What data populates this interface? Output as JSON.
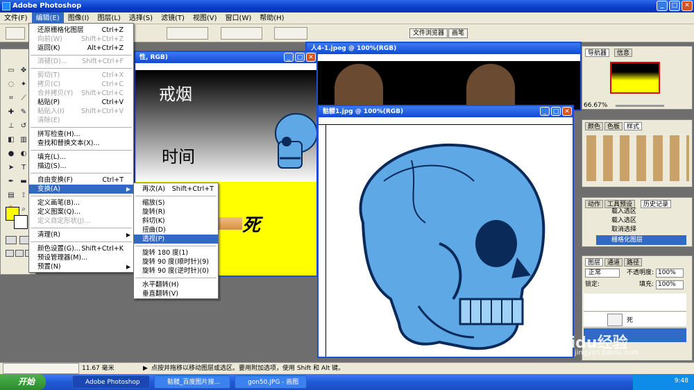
{
  "app": {
    "title": "Adobe Photoshop"
  },
  "menubar": [
    "文件(F)",
    "编辑(E)",
    "图像(I)",
    "图层(L)",
    "选择(S)",
    "滤镜(T)",
    "视图(V)",
    "窗口(W)",
    "帮助(H)"
  ],
  "optbar": {
    "tab1": "文件浏览器",
    "tab2": "画笔"
  },
  "doc1": {
    "title": "性, RGB)",
    "text1": "戒烟",
    "text2": "时间",
    "text3": "死"
  },
  "doc_back": {
    "title": "人4-1.jpeg @ 100%(RGB)"
  },
  "doc2": {
    "title": "骷髅1.jpg @ 100%(RGB)"
  },
  "edit_menu": [
    {
      "label": "还原栅格化图层",
      "shortcut": "Ctrl+Z",
      "disabled": false
    },
    {
      "label": "向前(W)",
      "shortcut": "Shift+Ctrl+Z",
      "disabled": true
    },
    {
      "label": "返回(K)",
      "shortcut": "Alt+Ctrl+Z",
      "disabled": false
    },
    {
      "label": "消褪(D)...",
      "shortcut": "Shift+Ctrl+F",
      "disabled": true
    },
    {
      "label": "剪切(T)",
      "shortcut": "Ctrl+X",
      "disabled": true
    },
    {
      "label": "拷贝(C)",
      "shortcut": "Ctrl+C",
      "disabled": true
    },
    {
      "label": "合并拷贝(Y)",
      "shortcut": "Shift+Ctrl+C",
      "disabled": true
    },
    {
      "label": "粘贴(P)",
      "shortcut": "Ctrl+V",
      "disabled": false
    },
    {
      "label": "粘贴入(I)",
      "shortcut": "Shift+Ctrl+V",
      "disabled": true
    },
    {
      "label": "清除(E)",
      "shortcut": "",
      "disabled": true
    },
    {
      "label": "拼写检查(H)...",
      "shortcut": "",
      "disabled": false
    },
    {
      "label": "查找和替换文本(X)...",
      "shortcut": "",
      "disabled": false
    },
    {
      "label": "填充(L)...",
      "shortcut": "",
      "disabled": false
    },
    {
      "label": "描边(S)...",
      "shortcut": "",
      "disabled": false
    },
    {
      "label": "自由变换(F)",
      "shortcut": "Ctrl+T",
      "disabled": false
    },
    {
      "label": "变换(A)",
      "shortcut": "",
      "disabled": false
    },
    {
      "label": "定义画笔(B)...",
      "shortcut": "",
      "disabled": false
    },
    {
      "label": "定义图案(Q)...",
      "shortcut": "",
      "disabled": false
    },
    {
      "label": "定义自定形状(J)...",
      "shortcut": "",
      "disabled": true
    },
    {
      "label": "清理(R)",
      "shortcut": "",
      "disabled": false
    },
    {
      "label": "颜色设置(G)...",
      "shortcut": "Shift+Ctrl+K",
      "disabled": false
    },
    {
      "label": "预设管理器(M)...",
      "shortcut": "",
      "disabled": false
    },
    {
      "label": "预置(N)",
      "shortcut": "",
      "disabled": false
    }
  ],
  "transform_menu": [
    {
      "label": "再次(A)",
      "shortcut": "Shift+Ctrl+T"
    },
    {
      "label": "缩放(S)",
      "shortcut": ""
    },
    {
      "label": "旋转(R)",
      "shortcut": ""
    },
    {
      "label": "斜切(K)",
      "shortcut": ""
    },
    {
      "label": "扭曲(D)",
      "shortcut": ""
    },
    {
      "label": "透视(P)",
      "shortcut": ""
    },
    {
      "label": "旋转 180 度(1)",
      "shortcut": ""
    },
    {
      "label": "旋转 90 度(顺时针)(9)",
      "shortcut": ""
    },
    {
      "label": "旋转 90 度(逆时针)(0)",
      "shortcut": ""
    },
    {
      "label": "水平翻转(H)",
      "shortcut": ""
    },
    {
      "label": "垂直翻转(V)",
      "shortcut": ""
    }
  ],
  "navigator": {
    "tab1": "导航器",
    "tab2": "信息",
    "zoom": "66.67%"
  },
  "swatches": {
    "tab1": "颜色",
    "tab2": "色板",
    "tab3": "样式"
  },
  "history": {
    "tab1": "动作",
    "tab2": "工具预设",
    "tab3": "历史记录",
    "items": [
      "载入选区",
      "载入选区",
      "取消选择",
      "栅格化图层"
    ]
  },
  "layers": {
    "tab1": "图层",
    "tab2": "通道",
    "tab3": "路径",
    "blend": "正常",
    "opacity_label": "不透明度:",
    "opacity": "100%",
    "lock_label": "锁定:",
    "fill_label": "填充:",
    "fill": "100%",
    "layer_name": "死"
  },
  "status": {
    "measure": "11.67 毫米",
    "hint": "点按并拖移以移动图层或选区。要用附加选项，使用 Shift 和 Alt 键。"
  },
  "taskbar": {
    "start": "开始",
    "tasks": [
      "Adobe Photoshop",
      "骷髅_百度图片搜...",
      "gon50.JPG - 画图"
    ],
    "time": "9:48"
  },
  "watermark": {
    "text1": "Baidu经验",
    "text2": "jingyan.baidu.com"
  },
  "colors": {
    "accent": "#316ac5",
    "fg_swatch": "#ffff00",
    "skull": "#5fa8e6"
  }
}
